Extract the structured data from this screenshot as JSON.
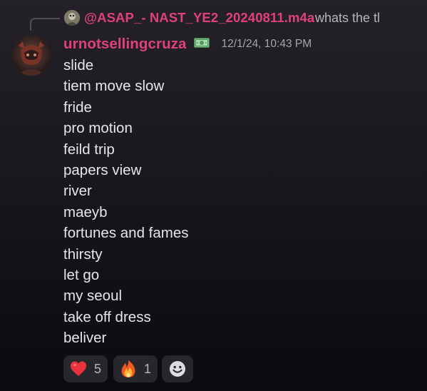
{
  "reply": {
    "username": "@ASAP_- NAST_YE2_20240811.m4a",
    "preview": "whats the tl",
    "avatar_icon": "user-avatar-icon"
  },
  "message": {
    "author": "urnotsellingcruza",
    "role_icon": "money-badge-icon",
    "timestamp": "12/1/24, 10:43 PM",
    "author_color": "#e0417e",
    "lines": [
      "slide",
      "tiem move slow",
      "fride",
      "pro motion",
      "feild trip",
      "papers view",
      "river",
      "maeyb",
      "fortunes and fames",
      "thirsty",
      "let go",
      "my seoul",
      "take off dress",
      "beliver"
    ]
  },
  "reactions": [
    {
      "emoji": "heart-icon",
      "count": "5"
    },
    {
      "emoji": "fire-icon",
      "count": "1"
    }
  ],
  "add_reaction_icon": "smiley-icon"
}
